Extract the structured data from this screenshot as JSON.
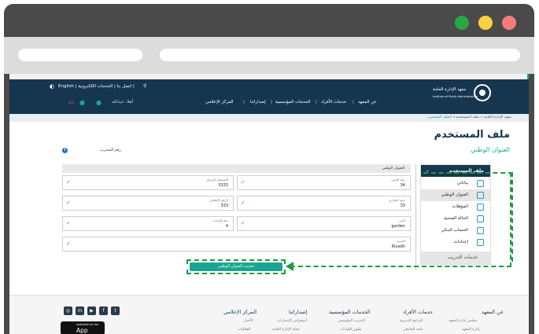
{
  "window": {
    "dots": {
      "green": "#29a745",
      "yellow": "#f7d23e",
      "red": "#f27c7c"
    }
  },
  "site": {
    "top_links": "English  |  اتصل بنا  |  الخدمات الإلكترونية  |",
    "user_name": "أهلا، عبدالله",
    "nav": [
      "عن المعهد",
      "خدمات الأفراد",
      "الخدمات المؤسسية",
      "إصداراتنا",
      "المركز الإعلامي"
    ],
    "logo_ar": "معهد الإدارة العامة",
    "logo_en": "Institute of Public Administration"
  },
  "breadcrumb": [
    "معهد الإدارة العامة",
    "ملف المستخدم",
    "الملف الشخصي"
  ],
  "page": {
    "title": "ملف المستخدم",
    "subtitle": "العنوان الوطني",
    "trainee_label": "رقم المتدرب",
    "form_header": "العنوان الوطني",
    "fields": [
      {
        "label": "رقم المبنى",
        "value": "34"
      },
      {
        "label": "الصندوق البريدي",
        "value": "3333"
      },
      {
        "label": "اسم الشارع",
        "value": "33"
      },
      {
        "label": "الرقم الإضافي",
        "value": "333"
      },
      {
        "label": "الحي",
        "value": "garden"
      },
      {
        "label": "رقم الوحدة",
        "value": "4"
      },
      {
        "label": "المدينة",
        "value": "Riyadh"
      }
    ],
    "update_button": "تحديث العنوان الوطني"
  },
  "sidebar": {
    "header": "ملف المستخدم",
    "items": [
      {
        "label": "بياناتي",
        "icon": "user-icon"
      },
      {
        "label": "العنوان الوطني",
        "icon": "location-icon"
      },
      {
        "label": "المؤهلات",
        "icon": "certificate-icon"
      },
      {
        "label": "الحالة الصحية",
        "icon": "health-icon"
      },
      {
        "label": "الحساب البنكي",
        "icon": "bank-icon"
      },
      {
        "label": "إعدادات",
        "icon": "settings-icon"
      }
    ],
    "footer": "خدمات التدريب"
  },
  "footer": {
    "columns": [
      {
        "title": "عن المعهد",
        "links": [
          "مجلس إدارة المعهد",
          "إدارة المعهد"
        ]
      },
      {
        "title": "خدمات الأفراد",
        "links": [
          "البرامج التدريبية",
          "ماجد الجامعي"
        ]
      },
      {
        "title": "الخدمات المؤسسية",
        "links": [
          "التدريب المؤسسي",
          "تطوير القيادات"
        ]
      },
      {
        "title": "إصداراتنا",
        "links": [
          "استعراض الإصدارات",
          "مجلة الإدارة العامة"
        ]
      },
      {
        "title": "المركز الإعلامي",
        "links": [
          "الأخبار",
          "الفعاليات"
        ]
      }
    ],
    "appstore_small": "Available on the",
    "appstore_big": "App Store"
  }
}
